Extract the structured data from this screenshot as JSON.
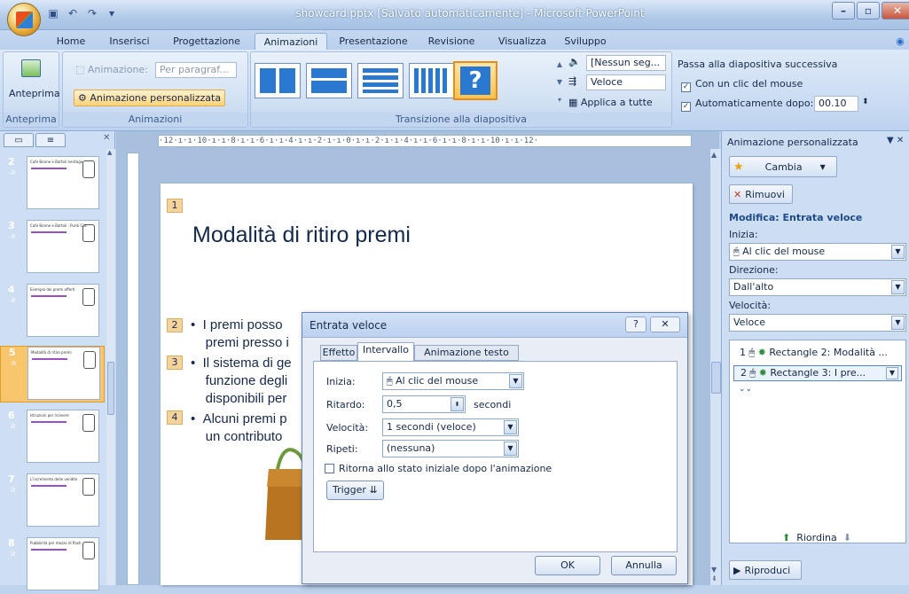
{
  "window": {
    "title": "showcard.pptx [Salvato automaticamente] - Microsoft PowerPoint"
  },
  "tabs": [
    "Home",
    "Inserisci",
    "Progettazione",
    "Animazioni",
    "Presentazione",
    "Revisione",
    "Visualizza",
    "Sviluppo"
  ],
  "ribbon": {
    "preview_label": "Anteprima",
    "animation_label": "Animazione:",
    "animation_value": "Per paragraf...",
    "custom_animation": "Animazione personalizzata",
    "group_preview": "Anteprima",
    "group_animations": "Animazioni",
    "sound_value": "[Nessun seg...",
    "speed_value": "Veloce",
    "apply_all": "Applica a tutte",
    "next_slide_header": "Passa alla diapositiva successiva",
    "on_click": "Con un clic del mouse",
    "auto_after": "Automaticamente dopo:",
    "auto_after_value": "00.10",
    "group_transition": "Transizione alla diapositiva"
  },
  "slides_pane": {
    "slides": [
      {
        "num": "2",
        "caption": "Cafe Bonne e Bartoli heritage"
      },
      {
        "num": "3",
        "caption": "Cafe Bonne e Bartoli : Punti Cos"
      },
      {
        "num": "4",
        "caption": "Esempio dei premi offerti"
      },
      {
        "num": "5",
        "caption": "Modalità di ritiro premi"
      },
      {
        "num": "6",
        "caption": "Istruzioni per ricevere"
      },
      {
        "num": "7",
        "caption": "L'incremento delle vendite"
      },
      {
        "num": "8",
        "caption": "Pubblicità per mezzo di flash"
      }
    ]
  },
  "ruler_text": "·12·ı·ı·10·ı·ı·8·ı·ı·6·ı·ı·4·ı·ı·2·ı·ı·0·ı·ı·2·ı·ı·4·ı·ı·6·ı·ı·8·ı·ı·10·ı·ı·12·",
  "slide": {
    "title_num": "1",
    "title": "Modalità di ritiro premi",
    "bullets": [
      {
        "num": "2",
        "line1": "I premi posso",
        "line2": "premi presso i"
      },
      {
        "num": "3",
        "line1": "Il sistema di ge",
        "line2": "funzione degli",
        "line3": "disponibili per"
      },
      {
        "num": "4",
        "line1": "Alcuni premi p",
        "line2": "un contributo"
      }
    ]
  },
  "task_pane": {
    "title": "Animazione personalizzata",
    "change_btn": "Cambia",
    "remove_btn": "Rimuovi",
    "modify_label": "Modifica: Entrata veloce",
    "start_label": "Inizia:",
    "start_value": "Al clic del mouse",
    "direction_label": "Direzione:",
    "direction_value": "Dall'alto",
    "speed_label": "Velocità:",
    "speed_value": "Veloce",
    "items": [
      {
        "num": "1",
        "text": "Rectangle 2: Modalità ..."
      },
      {
        "num": "2",
        "text": "Rectangle 3: I pre..."
      }
    ],
    "reorder": "Riordina",
    "play_btn": "Riproduci"
  },
  "dialog": {
    "title": "Entrata veloce",
    "help": "?",
    "tabs": [
      "Effetto",
      "Intervallo",
      "Animazione testo"
    ],
    "start_label": "Inizia:",
    "start_value": "Al clic del mouse",
    "delay_label": "Ritardo:",
    "delay_value": "0,5",
    "delay_unit": "secondi",
    "speed_label": "Velocità:",
    "speed_value": "1 secondi (veloce)",
    "repeat_label": "Ripeti:",
    "repeat_value": "(nessuna)",
    "rewind_label": "Ritorna allo stato iniziale dopo l'animazione",
    "trigger_btn": "Trigger",
    "ok_btn": "OK",
    "cancel_btn": "Annulla"
  }
}
